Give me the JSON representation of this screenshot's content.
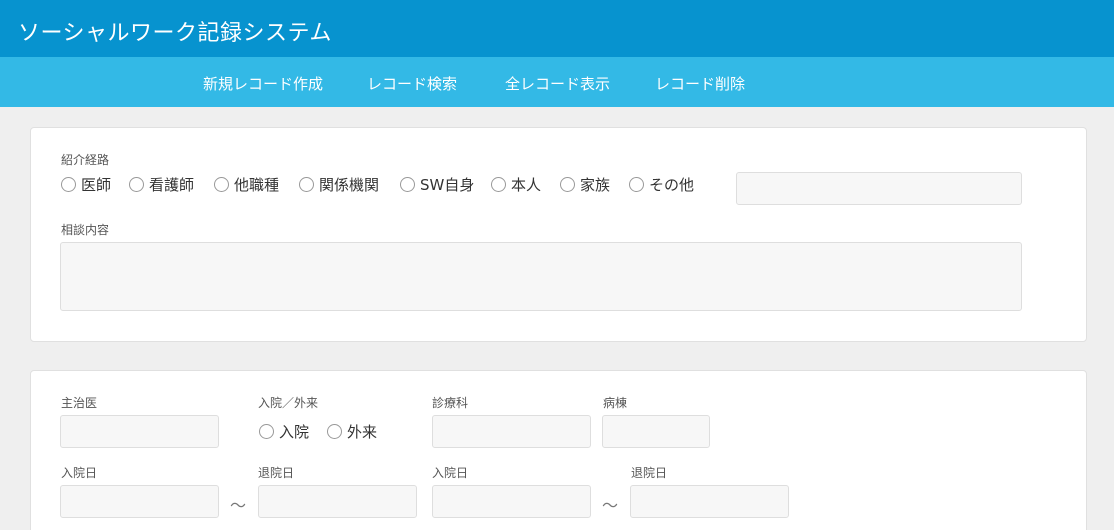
{
  "app": {
    "title": "ソーシャルワーク記録システム"
  },
  "nav": {
    "items": [
      {
        "label": "新規レコード作成"
      },
      {
        "label": "レコード検索"
      },
      {
        "label": "全レコード表示"
      },
      {
        "label": "レコード削除"
      }
    ]
  },
  "referral": {
    "label": "紹介経路",
    "options": [
      "医師",
      "看護師",
      "他職種",
      "関係機関",
      "SW自身",
      "本人",
      "家族",
      "その他"
    ],
    "other_value": ""
  },
  "consultation": {
    "label": "相談内容",
    "value": ""
  },
  "patient": {
    "attending_doctor_label": "主治医",
    "inout_label": "入院／外来",
    "inout_options": [
      "入院",
      "外来"
    ],
    "department_label": "診療科",
    "ward_label": "病棟",
    "admission_date_label": "入院日",
    "discharge_date_label": "退院日",
    "admission_date2_label": "入院日",
    "discharge_date2_label": "退院日",
    "range_separator": "～"
  }
}
